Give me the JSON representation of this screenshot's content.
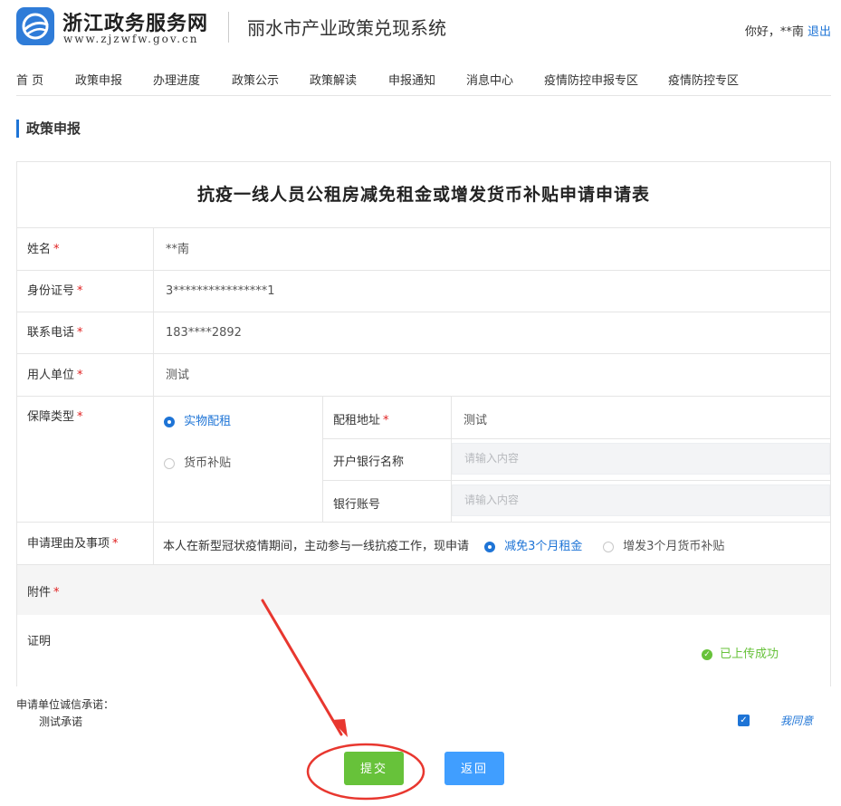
{
  "header": {
    "site_name": "浙江政务服务网",
    "site_url": "www.zjzwfw.gov.cn",
    "system_name": "丽水市产业政策兑现系统",
    "greeting": "你好，**南",
    "logout": "退出"
  },
  "nav": {
    "items": [
      "首 页",
      "政策申报",
      "办理进度",
      "政策公示",
      "政策解读",
      "申报通知",
      "消息中心",
      "疫情防控申报专区",
      "疫情防控专区"
    ]
  },
  "section_title": "政策申报",
  "form": {
    "title": "抗疫一线人员公租房减免租金或增发货币补贴申请申请表",
    "name": {
      "label": "姓名",
      "required": "*",
      "value": "**南"
    },
    "id_number": {
      "label": "身份证号",
      "required": "*",
      "value": "3****************1"
    },
    "phone": {
      "label": "联系电话",
      "required": "*",
      "value": "183****2892"
    },
    "employer": {
      "label": "用人单位",
      "required": "*",
      "value": "测试"
    },
    "guarantee_type": {
      "label": "保障类型",
      "required": "*",
      "options": [
        "实物配租",
        "货币补贴"
      ],
      "selected": "实物配租"
    },
    "rental_address": {
      "label": "配租地址",
      "required": "*",
      "value": "测试"
    },
    "bank_name": {
      "label": "开户银行名称",
      "placeholder": "请输入内容"
    },
    "bank_account": {
      "label": "银行账号",
      "placeholder": "请输入内容"
    },
    "reason": {
      "label": "申请理由及事项",
      "required": "*",
      "text": "本人在新型冠状疫情期间，主动参与一线抗疫工作，现申请",
      "options": [
        "减免3个月租金",
        "增发3个月货币补贴"
      ],
      "selected": "减免3个月租金"
    },
    "attachment": {
      "label": "附件",
      "required": "*"
    },
    "proof": {
      "label": "证明",
      "status": "已上传成功"
    }
  },
  "pledge": {
    "label": "申请单位诚信承诺：",
    "text": "测试承诺",
    "agree": "我同意",
    "checked": true
  },
  "buttons": {
    "submit": "提交",
    "back": "返回"
  },
  "colors": {
    "accent": "#1e74d6",
    "success": "#67c23a",
    "primary_button": "#409eff",
    "required": "#e02020",
    "annotation": "#e8372f"
  }
}
